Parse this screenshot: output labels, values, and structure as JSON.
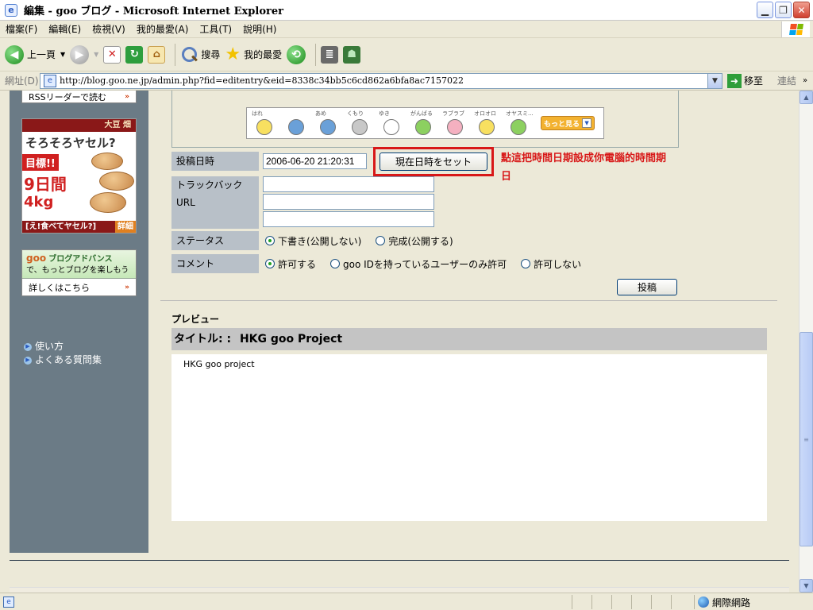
{
  "window": {
    "title": "編集 - goo ブログ - Microsoft Internet Explorer"
  },
  "menu": [
    "檔案(F)",
    "編輯(E)",
    "檢視(V)",
    "我的最愛(A)",
    "工具(T)",
    "說明(H)"
  ],
  "toolbar": {
    "back_label": "上一頁",
    "search_label": "搜尋",
    "favorites_label": "我的最愛"
  },
  "address": {
    "label": "網址(D)",
    "url": "http://blog.goo.ne.jp/admin.php?fid=editentry&eid=8338c34bb5c6cd862a6bfa8ac7157022",
    "go_label": "移至",
    "links_label": "連結"
  },
  "sidebar": {
    "rss_label": "RSSリーダーで読む",
    "ad": {
      "brand": "大豆 畑",
      "headline": "そろそろヤセル?",
      "target": "目標!!",
      "days": "9日間",
      "kg": "4kg",
      "footer": "[え!食べてヤセル?]",
      "detail": "詳細"
    },
    "advance": {
      "goo": "goo",
      "title": "ブログアドバンス",
      "tagline": "で、もっとブログを楽しもう",
      "link": "詳しくはこちら"
    },
    "links": [
      "使い方",
      "よくある質問集"
    ]
  },
  "emoji": {
    "labels": [
      "はれ",
      "",
      "あめ",
      "くもり",
      "ゆき",
      "がんばる",
      "ラブラブ",
      "オロオロ",
      "オヤスミ..."
    ],
    "more_label": "もっと見る"
  },
  "form": {
    "date_label": "投稿日時",
    "date_value": "2006-06-20 21:20:31",
    "set_now_label": "現在日時をセット",
    "annotation": "點這把時間日期設成你電腦的時間期日",
    "trackback_label": "トラックバック URL",
    "status_label": "ステータス",
    "status_options": [
      "下書き(公開しない)",
      "完成(公開する)"
    ],
    "comment_label": "コメント",
    "comment_options": [
      "許可する",
      "goo IDを持っているユーザーのみ許可",
      "許可しない"
    ],
    "post_label": "投稿"
  },
  "preview": {
    "heading": "プレビュー",
    "title_prefix": "タイトル: :",
    "title": "HKG goo Project",
    "body": "HKG goo project"
  },
  "status": {
    "zone": "網際網路"
  }
}
